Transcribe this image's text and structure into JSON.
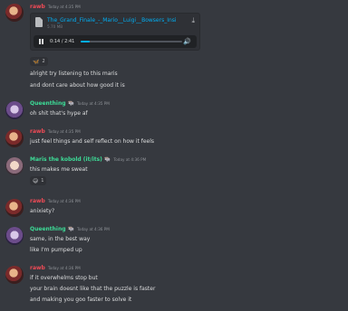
{
  "messages": [
    {
      "author": "rawb",
      "timestamp": "Today at 4:35 PM",
      "attachment": {
        "file_name": "The_Grand_Finale_-_Mario__Luigi__Bowsers_Insi",
        "file_size": "5.70 MB",
        "time_display": "0:14 / 2:41",
        "progress": 0.09,
        "icons": [
          "file-icon",
          "download-icon",
          "pause-icon",
          "volume-icon"
        ]
      },
      "reaction": {
        "emoji": "🦋",
        "count": "2"
      },
      "lines": [
        "alright try listening to this maris",
        "and dont care about how good it is"
      ]
    },
    {
      "author": "Queenthing",
      "badge": "🐃",
      "timestamp": "Today at 4:35 PM",
      "lines": [
        "oh shit that's hype af"
      ]
    },
    {
      "author": "rawb",
      "timestamp": "Today at 4:35 PM",
      "lines": [
        "just feel things and self reflect on how it feels"
      ]
    },
    {
      "author": "Maris the kobold (it/its)",
      "badge": "🐃",
      "timestamp": "Today at 4:36 PM",
      "lines": [
        "this makes me sweat"
      ],
      "reaction": {
        "emoji": "😅",
        "count": "1"
      }
    },
    {
      "author": "rawb",
      "timestamp": "Today at 4:36 PM",
      "lines": [
        "anixiety?"
      ]
    },
    {
      "author": "Queenthing",
      "badge": "🐃",
      "timestamp": "Today at 4:36 PM",
      "lines": [
        "same, in the best way",
        "like I'm pumped up"
      ]
    },
    {
      "author": "rawb",
      "timestamp": "Today at 4:36 PM",
      "lines": [
        "if it overwhelms stop but",
        "your brain doesnt like that the puzzle is faster",
        "and making you goo faster to solve it"
      ]
    }
  ],
  "colors": {
    "background": "#36393f",
    "rawb_name": "#f04a56",
    "green_name": "#3ddc97",
    "link": "#00aff4"
  }
}
